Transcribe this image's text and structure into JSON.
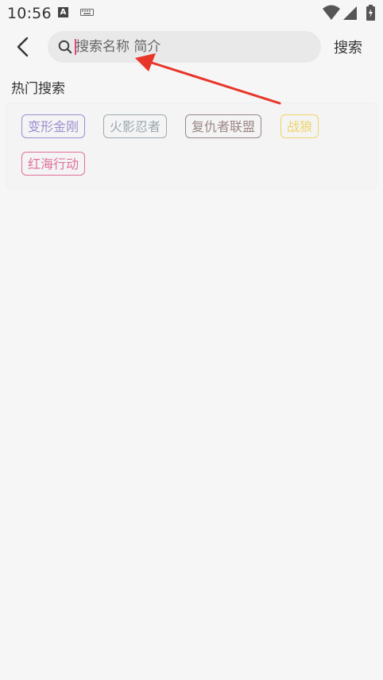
{
  "status_bar": {
    "time": "10:56",
    "a_icon_letter": "A",
    "icons": [
      "a-icon",
      "keyboard-icon",
      "wifi-icon",
      "signal-icon",
      "battery-icon"
    ]
  },
  "header": {
    "back_icon": "back-icon",
    "search": {
      "placeholder": "搜索名称 简介",
      "value": ""
    },
    "search_button_label": "搜索"
  },
  "hot_search": {
    "title": "热门搜索",
    "tags": [
      {
        "label": "变形金刚",
        "color": "#9d8ed0"
      },
      {
        "label": "火影忍者",
        "color": "#9aa9b0"
      },
      {
        "label": "复仇者联盟",
        "color": "#9a8786"
      },
      {
        "label": "战狼",
        "color": "#f0d36a"
      },
      {
        "label": "红海行动",
        "color": "#e0709d"
      }
    ]
  },
  "annotation": {
    "arrow_color": "#e8362b"
  }
}
